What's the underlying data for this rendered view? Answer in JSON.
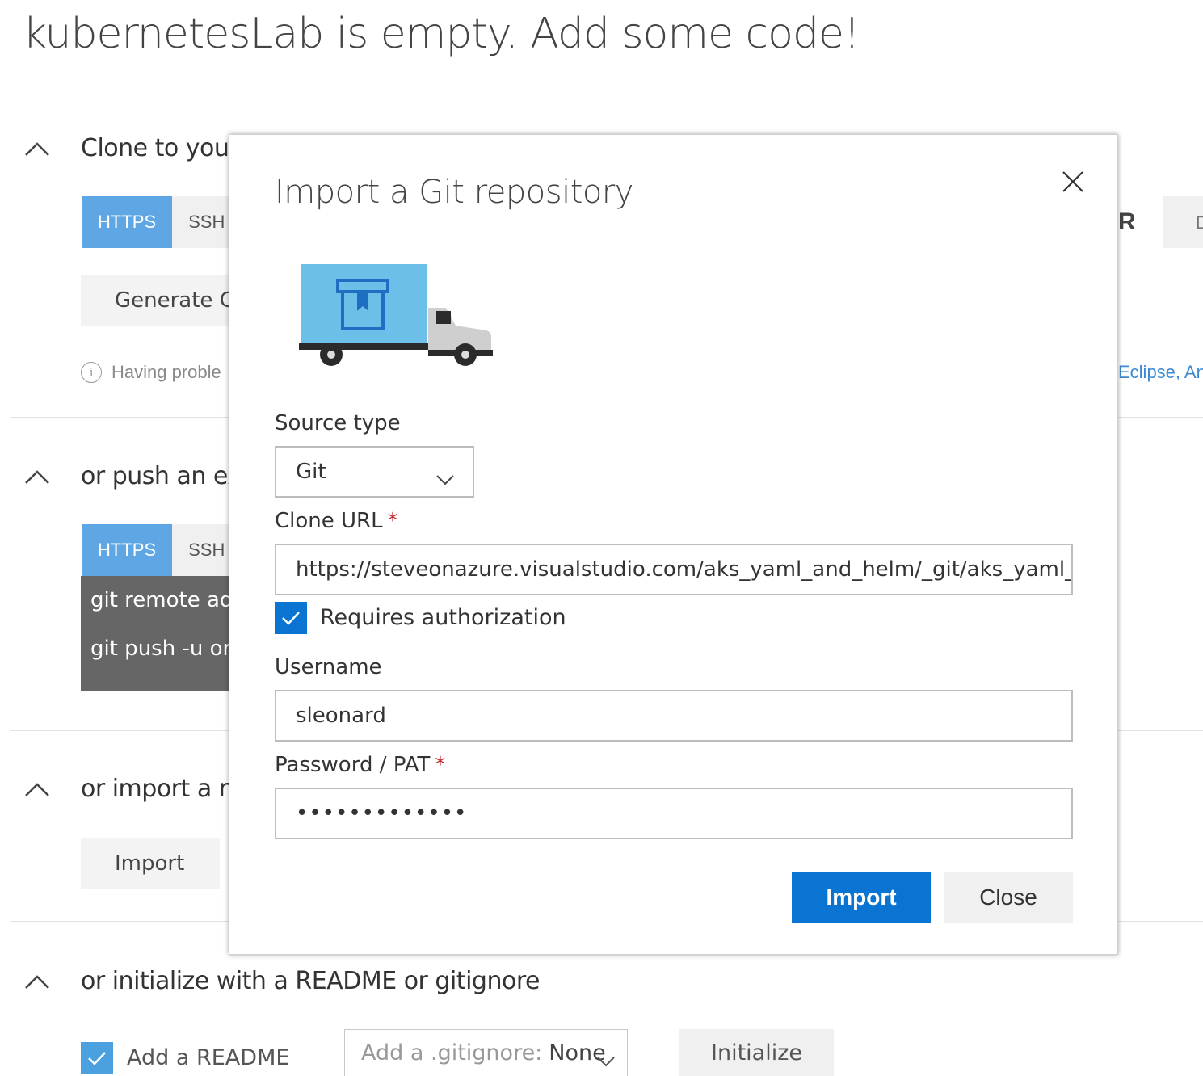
{
  "page": {
    "title": "kubernetesLab is empty. Add some code!"
  },
  "sections": {
    "clone": {
      "title": "Clone to you",
      "tabs": [
        "HTTPS",
        "SSH"
      ],
      "generate_button": "Generate G",
      "help_text": "Having proble",
      "right_fragment_letter": "R",
      "right_fragment_tab": "D",
      "right_fragment_link": "Eclipse, An"
    },
    "push": {
      "title": "or push an ex",
      "tabs": [
        "HTTPS",
        "SSH"
      ],
      "commands": [
        "git remote add",
        "git push -u or"
      ]
    },
    "import": {
      "title": "or import a r",
      "import_button": "Import"
    },
    "initialize": {
      "title": "or initialize with a README or gitignore",
      "readme_label": "Add a README",
      "readme_checked": true,
      "gitignore_prefix": "Add a .gitignore:",
      "gitignore_value": "None",
      "initialize_button": "Initialize"
    }
  },
  "modal": {
    "title": "Import a Git repository",
    "source_type_label": "Source type",
    "source_type_value": "Git",
    "clone_url_label": "Clone URL",
    "clone_url_value": "https://steveonazure.visualstudio.com/aks_yaml_and_helm/_git/aks_yaml_...",
    "required_marker": "*",
    "requires_auth_label": "Requires authorization",
    "requires_auth_checked": true,
    "username_label": "Username",
    "username_value": "sleonard",
    "password_label": "Password / PAT",
    "password_value": "•••••••••••••",
    "import_button": "Import",
    "close_button": "Close"
  },
  "colors": {
    "accent_blue": "#0a74d3",
    "tab_active": "#5ea6e4",
    "required_red": "#c4262e",
    "command_bg": "#666666"
  },
  "icons": [
    "chevron-up-icon",
    "close-icon",
    "truck-illustration",
    "chevron-down-icon",
    "checkmark-icon",
    "info-icon"
  ]
}
